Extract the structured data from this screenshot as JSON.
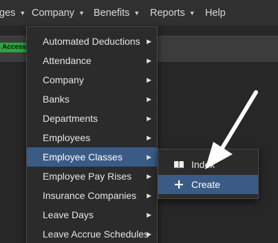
{
  "navbar": {
    "items": [
      {
        "label": "ges"
      },
      {
        "label": "Company"
      },
      {
        "label": "Benefits"
      },
      {
        "label": "Reports"
      },
      {
        "label": "Help"
      }
    ]
  },
  "banner": {
    "badge": "Access"
  },
  "menu": {
    "items": [
      {
        "label": "Automated Deductions"
      },
      {
        "label": "Attendance"
      },
      {
        "label": "Company"
      },
      {
        "label": "Banks"
      },
      {
        "label": "Departments"
      },
      {
        "label": "Employees"
      },
      {
        "label": "Employee Classes"
      },
      {
        "label": "Employee Pay Rises"
      },
      {
        "label": "Insurance Companies"
      },
      {
        "label": "Leave Days"
      },
      {
        "label": "Leave Accrue Schedules"
      }
    ],
    "active_index": 6
  },
  "submenu": {
    "items": [
      {
        "label": "Index",
        "icon": "book-icon"
      },
      {
        "label": "Create",
        "icon": "plus-icon"
      }
    ]
  },
  "colors": {
    "highlight": "#3a5b85",
    "badge": "#2aa640",
    "navbar": "#303030",
    "background": "#272727"
  }
}
